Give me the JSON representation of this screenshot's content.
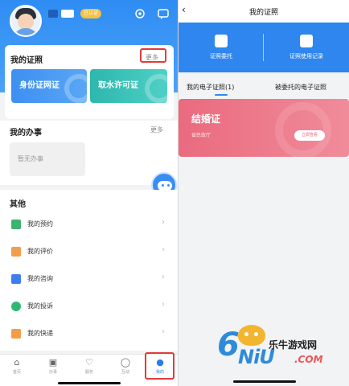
{
  "left": {
    "header": {
      "badge": "已认证"
    },
    "my_certs": {
      "title": "我的证照",
      "more": "更多",
      "tiles": [
        {
          "label": "身份证网证",
          "color": "#3d8ff2"
        },
        {
          "label": "取水许可证",
          "color": "#32c1b7"
        }
      ]
    },
    "my_affairs": {
      "title": "我的办事",
      "more": "更多",
      "empty": "暂无办事"
    },
    "other": {
      "title": "其他",
      "items": [
        {
          "label": "我的预约",
          "icon": "alarm-clock-icon",
          "color": "#3cb371"
        },
        {
          "label": "我的评价",
          "icon": "comment-icon",
          "color": "#f39c4a"
        },
        {
          "label": "我的咨询",
          "icon": "chat-icon",
          "color": "#3d7df2"
        },
        {
          "label": "我的投诉",
          "icon": "shield-icon",
          "color": "#2eb872"
        },
        {
          "label": "我的快递",
          "icon": "package-icon",
          "color": "#f39c4a"
        }
      ]
    },
    "tabbar": [
      {
        "icon": "⌂",
        "label": "首页",
        "name": "home"
      },
      {
        "icon": "▣",
        "label": "办事",
        "name": "services"
      },
      {
        "icon": "♡",
        "label": "服务",
        "name": "favorites"
      },
      {
        "icon": "◯",
        "label": "互动",
        "name": "interaction"
      },
      {
        "icon": "●",
        "label": "我的",
        "name": "mine",
        "active": true
      }
    ]
  },
  "right": {
    "title": "我的证照",
    "actions": [
      {
        "label": "证照委托",
        "icon": "delegate-icon"
      },
      {
        "label": "证照使用记录",
        "icon": "record-icon"
      }
    ],
    "tabs": [
      {
        "label": "我的电子证照(1)",
        "active": true
      },
      {
        "label": "被委托的电子证照",
        "active": false
      }
    ],
    "marriage_card": {
      "title": "结婚证",
      "issuer": "省民政厅",
      "button": "立即查看"
    }
  },
  "watermark": {
    "brand_cn": "乐牛游戏网",
    "brand_en": "NiU",
    "suffix": ".COM",
    "digit": "6"
  }
}
